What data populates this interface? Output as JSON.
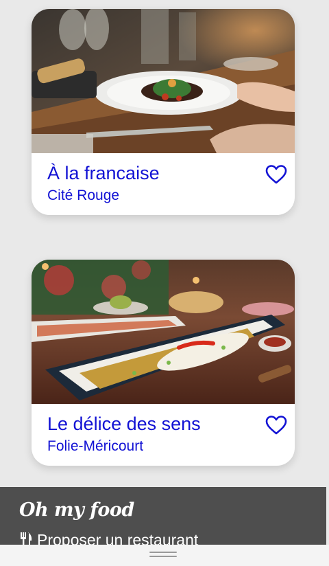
{
  "restaurants": [
    {
      "name": "À la francaise",
      "location": "Cité Rouge",
      "favorite_icon": "heart-outline-icon",
      "photo": "plated dish on restaurant table"
    },
    {
      "name": "Le délice des sens",
      "location": "Folie-Méricourt",
      "favorite_icon": "heart-outline-icon",
      "photo": "grilled fish on rectangular plate"
    }
  ],
  "footer": {
    "brand": "Oh my food",
    "propose_label": "Proposer un restaurant",
    "propose_icon": "cutlery-icon"
  },
  "colors": {
    "accent": "#1212d4",
    "background": "#e9e9e9",
    "footer_bg": "#4e4e4e"
  }
}
